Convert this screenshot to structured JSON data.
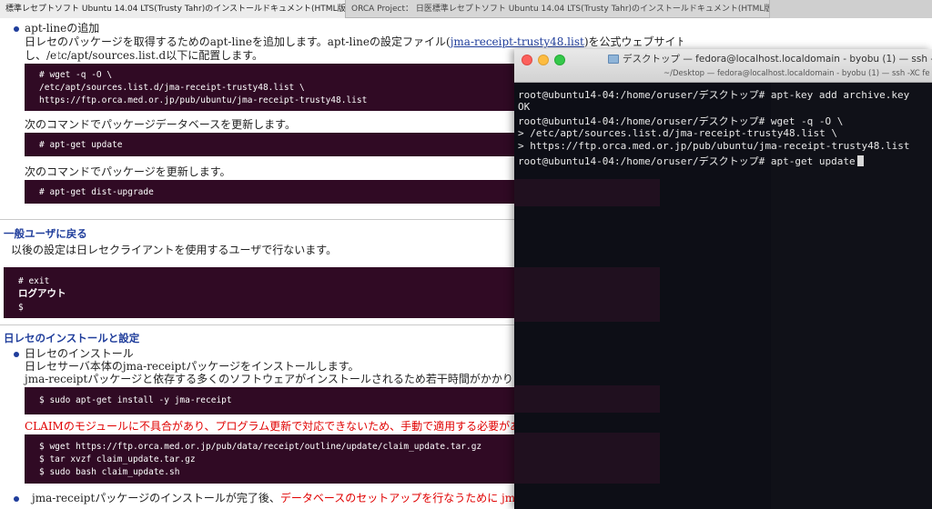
{
  "browser": {
    "tabs": [
      "標準レセプトソフト Ubuntu 14.04 LTS(Trusty Tahr)のインストールドキュメント(HTML版)",
      "ORCA Project： 日医標準レセプトソフト Ubuntu 14.04 LTS(Trusty Tahr)のインストールドキュメント(HTML版)",
      ""
    ]
  },
  "doc": {
    "aptline_title": "apt-lineの追加",
    "aptline_desc1_a": "日レセのパッケージを取得するためのapt-lineを追加します。apt-lineの設定ファイル(",
    "aptline_link": "jma-receipt-trusty48.list",
    "aptline_desc1_b": ")を公式ウェブサイトから取得",
    "aptline_desc2": "し、/etc/apt/sources.list.d以下に配置します。",
    "code1": [
      "# wget -q -O \\",
      "/etc/apt/sources.list.d/jma-receipt-trusty48.list \\",
      "https://ftp.orca.med.or.jp/pub/ubuntu/jma-receipt-trusty48.list"
    ],
    "update_desc": "次のコマンドでパッケージデータベースを更新します。",
    "code2": "# apt-get update",
    "upgrade_desc": "次のコマンドでパッケージを更新します。",
    "code3": "# apt-get dist-upgrade",
    "section1_title": "一般ユーザに戻る",
    "section1_desc": "以後の設定は日レセクライアントを使用するユーザで行ないます。",
    "code4": [
      "# exit",
      "ログアウト",
      "$"
    ],
    "section2_title": "日レセのインストールと設定",
    "install_title": "日レセのインストール",
    "install_desc1": "日レセサーバ本体のjma-receiptパッケージをインストールします。",
    "install_desc2": "jma-receiptパッケージと依存する多くのソフトウェアがインストールされるため若干時間がかかります。",
    "code5": "$ sudo apt-get install -y jma-receipt",
    "claim_warning": "CLAIMのモジュールに不具合があり、プログラム更新で対応できないため、手動で適用する必要があります。",
    "code6": [
      "$ wget https://ftp.orca.med.or.jp/pub/data/receipt/outline/update/claim_update.tar.gz",
      "$ tar xvzf claim_update.tar.gz",
      "$ sudo bash claim_update.sh"
    ],
    "last_line_a": "jma-receiptパッケージのインストールが完了後、",
    "last_line_b": "データベースのセットアップを行なうために jma-setup を"
  },
  "terminal": {
    "title": "デスクトップ — fedora@localhost.localdomain - byobu (1) — ssh -XC fe",
    "subtitle": "~/Desktop — fedora@localhost.localdomain - byobu (1) — ssh -XC fe",
    "lines": [
      "root@ubuntu14-04:/home/oruser/デスクトップ# apt-key add archive.key",
      "OK",
      "root@ubuntu14-04:/home/oruser/デスクトップ# wget -q -O \\",
      "> /etc/apt/sources.list.d/jma-receipt-trusty48.list \\",
      "> https://ftp.orca.med.or.jp/pub/ubuntu/jma-receipt-trusty48.list",
      "root@ubuntu14-04:/home/oruser/デスクトップ# apt-get update"
    ]
  }
}
